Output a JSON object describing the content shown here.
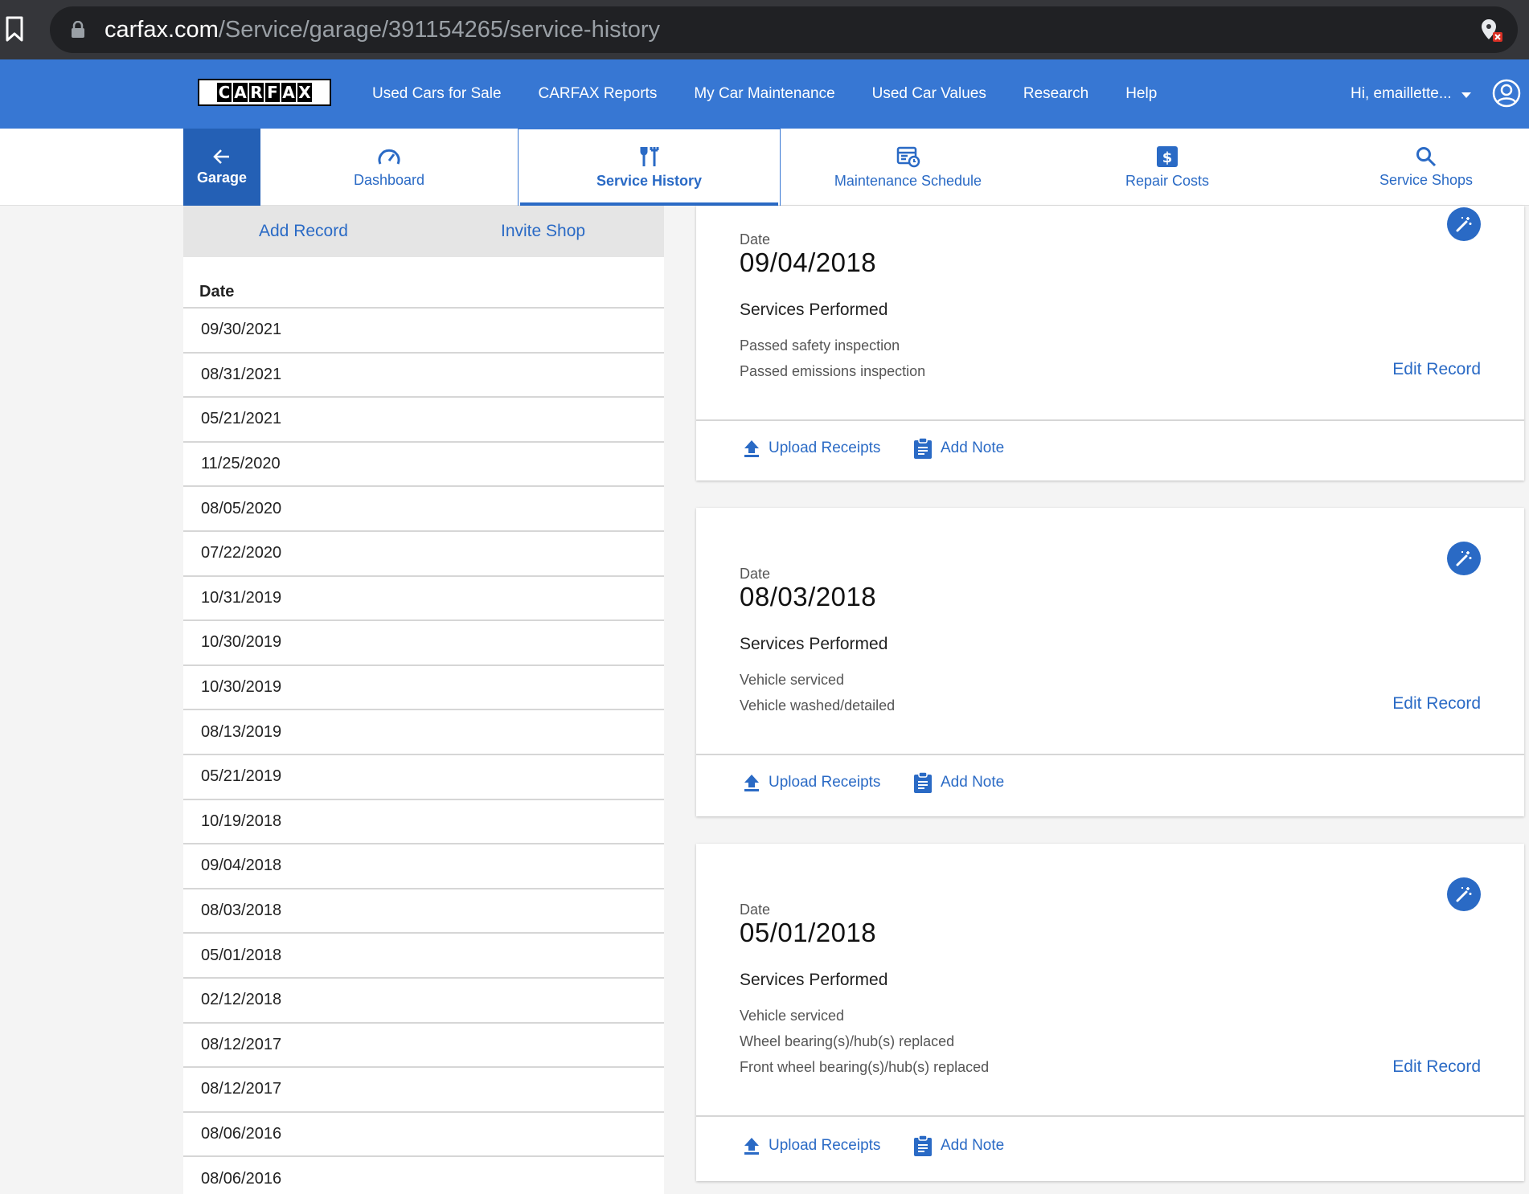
{
  "browser": {
    "url_host": "carfax.com",
    "url_path": "/Service/garage/391154265/service-history"
  },
  "topnav": {
    "logo_letters": [
      "C",
      "A",
      "R",
      "F",
      "A",
      "X"
    ],
    "links": [
      "Used Cars for Sale",
      "CARFAX Reports",
      "My Car Maintenance",
      "Used Car Values",
      "Research",
      "Help"
    ],
    "user_greeting": "Hi, emaillette..."
  },
  "subnav": {
    "garage_label": "Garage",
    "tabs": [
      "Dashboard",
      "Service History",
      "Maintenance Schedule",
      "Repair Costs",
      "Service Shops"
    ],
    "active_tab": "Service History"
  },
  "left_panel": {
    "add_record": "Add Record",
    "invite_shop": "Invite Shop",
    "column_header": "Date",
    "dates": [
      "09/30/2021",
      "08/31/2021",
      "05/21/2021",
      "11/25/2020",
      "08/05/2020",
      "07/22/2020",
      "10/31/2019",
      "10/30/2019",
      "10/30/2019",
      "08/13/2019",
      "05/21/2019",
      "10/19/2018",
      "09/04/2018",
      "08/03/2018",
      "05/01/2018",
      "02/12/2018",
      "08/12/2017",
      "08/12/2017",
      "08/06/2016",
      "08/06/2016"
    ]
  },
  "cards": [
    {
      "date_label": "Date",
      "date": "09/04/2018",
      "services_title": "Services Performed",
      "services": [
        "Passed safety inspection",
        "Passed emissions inspection"
      ],
      "edit_label": "Edit Record",
      "upload_label": "Upload Receipts",
      "note_label": "Add Note"
    },
    {
      "date_label": "Date",
      "date": "08/03/2018",
      "services_title": "Services Performed",
      "services": [
        "Vehicle serviced",
        "Vehicle washed/detailed"
      ],
      "edit_label": "Edit Record",
      "upload_label": "Upload Receipts",
      "note_label": "Add Note"
    },
    {
      "date_label": "Date",
      "date": "05/01/2018",
      "services_title": "Services Performed",
      "services": [
        "Vehicle serviced",
        "Wheel bearing(s)/hub(s) replaced",
        "Front wheel bearing(s)/hub(s) replaced"
      ],
      "edit_label": "Edit Record",
      "upload_label": "Upload Receipts",
      "note_label": "Add Note"
    }
  ],
  "colors": {
    "brand_blue": "#3777d3",
    "link_blue": "#2a6ac5",
    "garage_blue": "#2460b5"
  }
}
